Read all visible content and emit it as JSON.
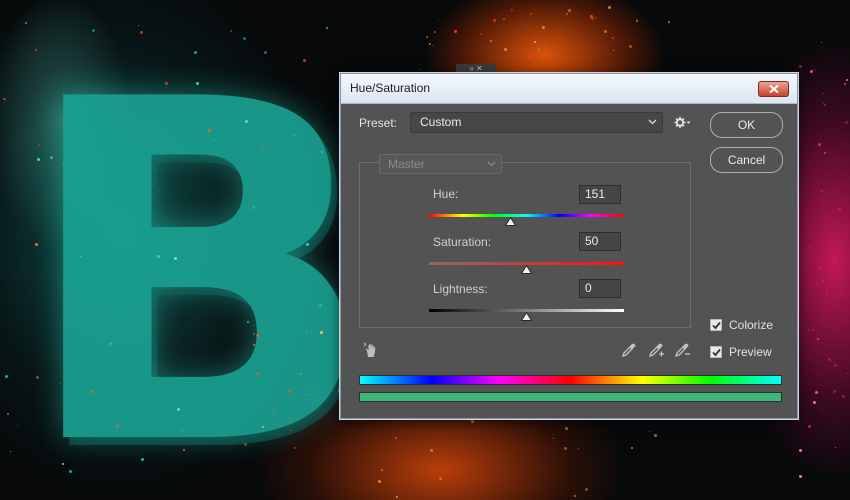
{
  "dialog": {
    "title": "Hue/Saturation",
    "preset": {
      "label": "Preset:",
      "value": "Custom"
    },
    "buttons": {
      "ok": "OK",
      "cancel": "Cancel"
    },
    "channel": {
      "value": "Master"
    },
    "sliders": [
      {
        "label": "Hue:",
        "value": "151",
        "position": 0.42
      },
      {
        "label": "Saturation:",
        "value": "50",
        "position": 0.5
      },
      {
        "label": "Lightness:",
        "value": "0",
        "position": 0.5
      }
    ],
    "checkboxes": {
      "colorize": {
        "label": "Colorize",
        "checked": true
      },
      "preview": {
        "label": "Preview",
        "checked": true
      }
    },
    "colors": {
      "panel": "#535353",
      "result_bar": "#3cb878",
      "close_button": "#c4422b"
    }
  },
  "icons": [
    "close-icon",
    "chevron-down-icon",
    "gear-icon",
    "on-image-adjust-hand-icon",
    "eyedropper-icon",
    "eyedropper-plus-icon",
    "eyedropper-minus-icon",
    "checkmark-icon"
  ]
}
